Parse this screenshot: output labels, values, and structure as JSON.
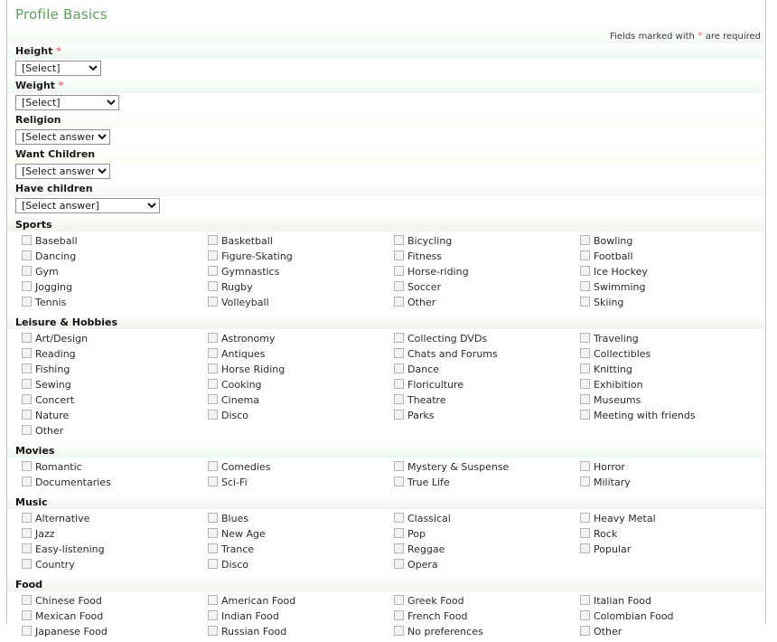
{
  "page": {
    "title": "Profile Basics",
    "required_note_prefix": "Fields marked with ",
    "required_star": "*",
    "required_note_suffix": " are required"
  },
  "fields": [
    {
      "label": "Height",
      "required": true,
      "value": "[Select]",
      "width": "w-small",
      "tint": "lbl-green"
    },
    {
      "label": "Weight",
      "required": true,
      "value": "[Select]",
      "width": "w-med",
      "tint": "lbl-green"
    },
    {
      "label": "Religion",
      "required": false,
      "value": "[Select answer]",
      "width": "w-ans",
      "tint": "lbl-cream"
    },
    {
      "label": "Want Children",
      "required": false,
      "value": "[Select answer]",
      "width": "w-ans",
      "tint": "lbl-cream"
    },
    {
      "label": "Have children",
      "required": false,
      "value": "[Select answer]",
      "width": "w-wide",
      "tint": "lbl-gray"
    }
  ],
  "sections": [
    {
      "title": "Sports",
      "tint": "",
      "columns": [
        [
          "Baseball",
          "Dancing",
          "Gym",
          "Jogging",
          "Tennis"
        ],
        [
          "Basketball",
          "Figure-Skating",
          "Gymnastics",
          "Rugby",
          "Volleyball"
        ],
        [
          "Bicycling",
          "Fitness",
          "Horse-riding",
          "Soccer",
          "Other"
        ],
        [
          "Bowling",
          "Football",
          "Ice Hockey",
          "Swimming",
          "Skiing"
        ]
      ]
    },
    {
      "title": "Leisure & Hobbies",
      "tint": "",
      "columns": [
        [
          "Art/Design",
          "Reading",
          "Fishing",
          "Sewing",
          "Concert",
          "Nature",
          "Other"
        ],
        [
          "Astronomy",
          "Antiques",
          "Horse Riding",
          "Cooking",
          "Cinema",
          "Disco"
        ],
        [
          "Collecting DVDs",
          "Chats and Forums",
          "Dance",
          "Floriculture",
          "Theatre",
          "Parks"
        ],
        [
          "Traveling",
          "Collectibles",
          "Knitting",
          "Exhibition",
          "Museums",
          "Meeting with friends"
        ]
      ]
    },
    {
      "title": "Movies",
      "tint": "green",
      "columns": [
        [
          "Romantic",
          "Documentaries"
        ],
        [
          "Comedies",
          "Sci-Fi"
        ],
        [
          "Mystery & Suspense",
          "True Life"
        ],
        [
          "Horror",
          "Military"
        ]
      ]
    },
    {
      "title": "Music",
      "tint": "",
      "columns": [
        [
          "Alternative",
          "Jazz",
          "Easy-listening",
          "Country"
        ],
        [
          "Blues",
          "New Age",
          "Trance",
          "Disco"
        ],
        [
          "Classical",
          "Pop",
          "Reggae",
          "Opera"
        ],
        [
          "Heavy Metal",
          "Rock",
          "Popular"
        ]
      ]
    },
    {
      "title": "Food",
      "tint": "",
      "columns": [
        [
          "Chinese Food",
          "Mexican Food",
          "Japanese Food"
        ],
        [
          "American Food",
          "Indian Food",
          "Russian Food"
        ],
        [
          "Greek Food",
          "French Food",
          "No preferences"
        ],
        [
          "Italian Food",
          "Colombian Food",
          "Other"
        ]
      ]
    }
  ]
}
